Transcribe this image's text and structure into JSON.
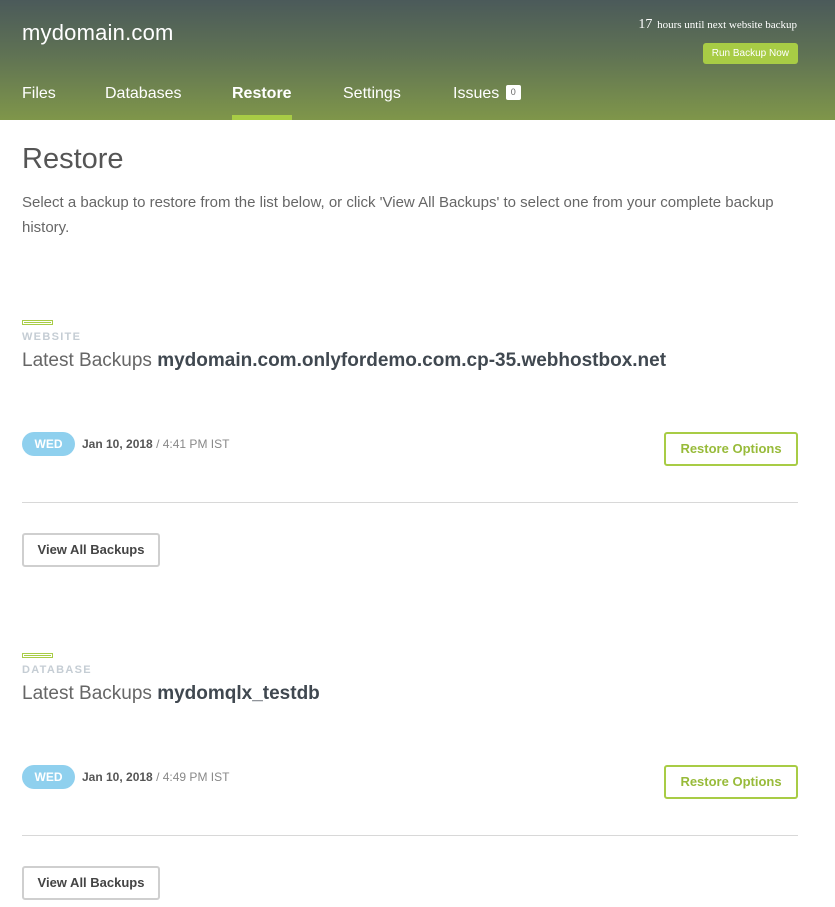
{
  "header": {
    "site_title": "mydomain.com",
    "timer_hours": "17",
    "timer_text": "hours until next website backup",
    "run_backup_label": "Run Backup Now"
  },
  "nav": {
    "tabs": [
      {
        "label": "Files"
      },
      {
        "label": "Databases"
      },
      {
        "label": "Restore",
        "active": true
      },
      {
        "label": "Settings"
      },
      {
        "label": "Issues",
        "badge": "0"
      }
    ]
  },
  "page": {
    "title": "Restore",
    "intro": "Select a backup to restore from the list below, or click 'View All Backups' to select one from your complete backup history."
  },
  "sections": [
    {
      "label": "WEBSITE",
      "heading_prefix": "Latest Backups",
      "name": "mydomain.com.onlyfordemo.com.cp-35.webhostbox.net",
      "day": "WED",
      "date": "Jan 10, 2018",
      "time": "/ 4:41 PM IST",
      "restore_label": "Restore Options",
      "view_all_label": "View All Backups"
    },
    {
      "label": "DATABASE",
      "heading_prefix": "Latest Backups",
      "name": "mydomqlx_testdb",
      "day": "WED",
      "date": "Jan 10, 2018",
      "time": "/ 4:49 PM IST",
      "restore_label": "Restore Options",
      "view_all_label": "View All Backups"
    }
  ],
  "colors": {
    "accent": "#a8cc45",
    "day_pill": "#8fd0ee",
    "header_top": "#4b5a5a",
    "header_bottom": "#7f964a"
  }
}
